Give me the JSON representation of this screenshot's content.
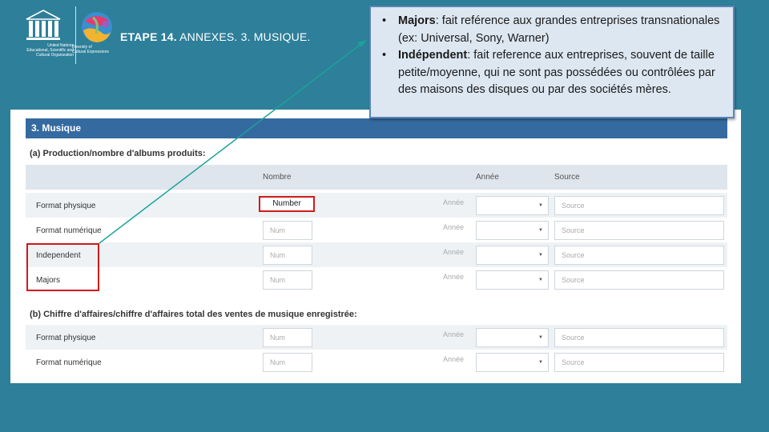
{
  "logos": {
    "unesco_caption": [
      "United Nations",
      "Educational, Scientific and",
      "Cultural Organization"
    ],
    "diversity_caption": [
      "Diversity of",
      "Cultural Expressions"
    ]
  },
  "slide": {
    "title_bold": "ETAPE 14.",
    "title_rest": " ANNEXES. 3. MUSIQUE."
  },
  "callout": {
    "items": [
      {
        "bullet": "•",
        "term": "Majors",
        "text": ": fait reférence aux grandes entreprises transnationales (ex: Universal, Sony, Warner)"
      },
      {
        "bullet": "•",
        "term": "Indépendent",
        "text": ": fait reference aux entreprises, souvent de taille petite/moyenne, qui ne sont pas possédées ou contrôlées par des maisons des disques ou par des sociétés mères."
      }
    ]
  },
  "form": {
    "section_title": "3. Musique",
    "part_a_title": "(a) Production/nombre d'albums produits:",
    "part_b_title": "(b) Chiffre d'affaires/chiffre d'affaires total des ventes de musique enregistrée:",
    "columns": {
      "nombre": "Nombre",
      "annee": "Année",
      "source": "Source"
    },
    "num_placeholder": "Num",
    "annee_placeholder": "Année",
    "source_placeholder": "Source",
    "number_tag": "Number",
    "rows_a": [
      {
        "label": "Format physique"
      },
      {
        "label": "Format numérique"
      },
      {
        "label": "Independent"
      },
      {
        "label": "Majors"
      }
    ],
    "rows_b": [
      {
        "label": "Format physique"
      },
      {
        "label": "Format numérique"
      }
    ]
  },
  "colors": {
    "background": "#2e7f99",
    "section_header": "#356aa0",
    "highlight": "#d11a1a",
    "connector": "#1aa39b"
  }
}
